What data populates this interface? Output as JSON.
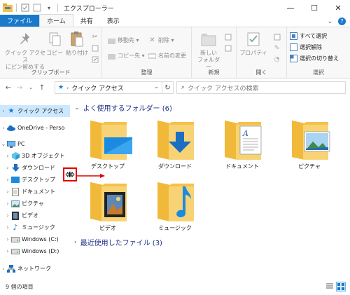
{
  "window": {
    "title": "エクスプローラー",
    "controls": {
      "minimize": "—",
      "maximize": "☐",
      "close": "✕"
    }
  },
  "ribbon": {
    "tabs": [
      {
        "label": "ファイル"
      },
      {
        "label": "ホーム"
      },
      {
        "label": "共有"
      },
      {
        "label": "表示"
      }
    ],
    "clipboard": {
      "pin_label_1": "クイック アクセス",
      "pin_label_2": "にピン留めする",
      "copy_label": "コピー",
      "paste_label": "貼り付け",
      "group_label": "クリップボード"
    },
    "organize": {
      "move_to": "移動先 ▾",
      "copy_to": "コピー先 ▾",
      "delete": "削除 ▾",
      "rename": "名前の変更",
      "group_label": "整理"
    },
    "new": {
      "new_folder_1": "新しい",
      "new_folder_2": "フォルダー",
      "group_label": "新規"
    },
    "open": {
      "properties": "プロパティ",
      "group_label": "開く"
    },
    "select": {
      "select_all": "すべて選択",
      "select_none": "選択解除",
      "invert": "選択の切り替え",
      "group_label": "選択"
    }
  },
  "address": {
    "path": "クイック アクセス",
    "search_placeholder": "クイック アクセスの検索"
  },
  "nav": {
    "items": [
      {
        "label": "クイック アクセス"
      },
      {
        "label": "OneDrive - Perso"
      },
      {
        "label": "PC"
      },
      {
        "label": "3D オブジェクト"
      },
      {
        "label": "ダウンロード"
      },
      {
        "label": "デスクトップ"
      },
      {
        "label": "ドキュメント"
      },
      {
        "label": "ピクチャ"
      },
      {
        "label": "ビデオ"
      },
      {
        "label": "ミュージック"
      },
      {
        "label": "Windows (C:)"
      },
      {
        "label": "Windows (D:)"
      },
      {
        "label": "ネットワーク"
      }
    ]
  },
  "content": {
    "frequent_header": "よく使用するフォルダー (6)",
    "recent_header": "最近使用したファイル (3)",
    "folders": [
      {
        "label": "デスクトップ"
      },
      {
        "label": "ダウンロード"
      },
      {
        "label": "ドキュメント"
      },
      {
        "label": "ピクチャ"
      },
      {
        "label": "ビデオ"
      },
      {
        "label": "ミュージック"
      }
    ]
  },
  "status": {
    "item_count": "9 個の項目"
  },
  "colors": {
    "accent": "#1979ca",
    "folder": "#f5c14a",
    "folder_dark": "#e3a824",
    "selected": "#cce8ff",
    "header_text": "#1e3287",
    "highlight_red": "#e00000"
  }
}
